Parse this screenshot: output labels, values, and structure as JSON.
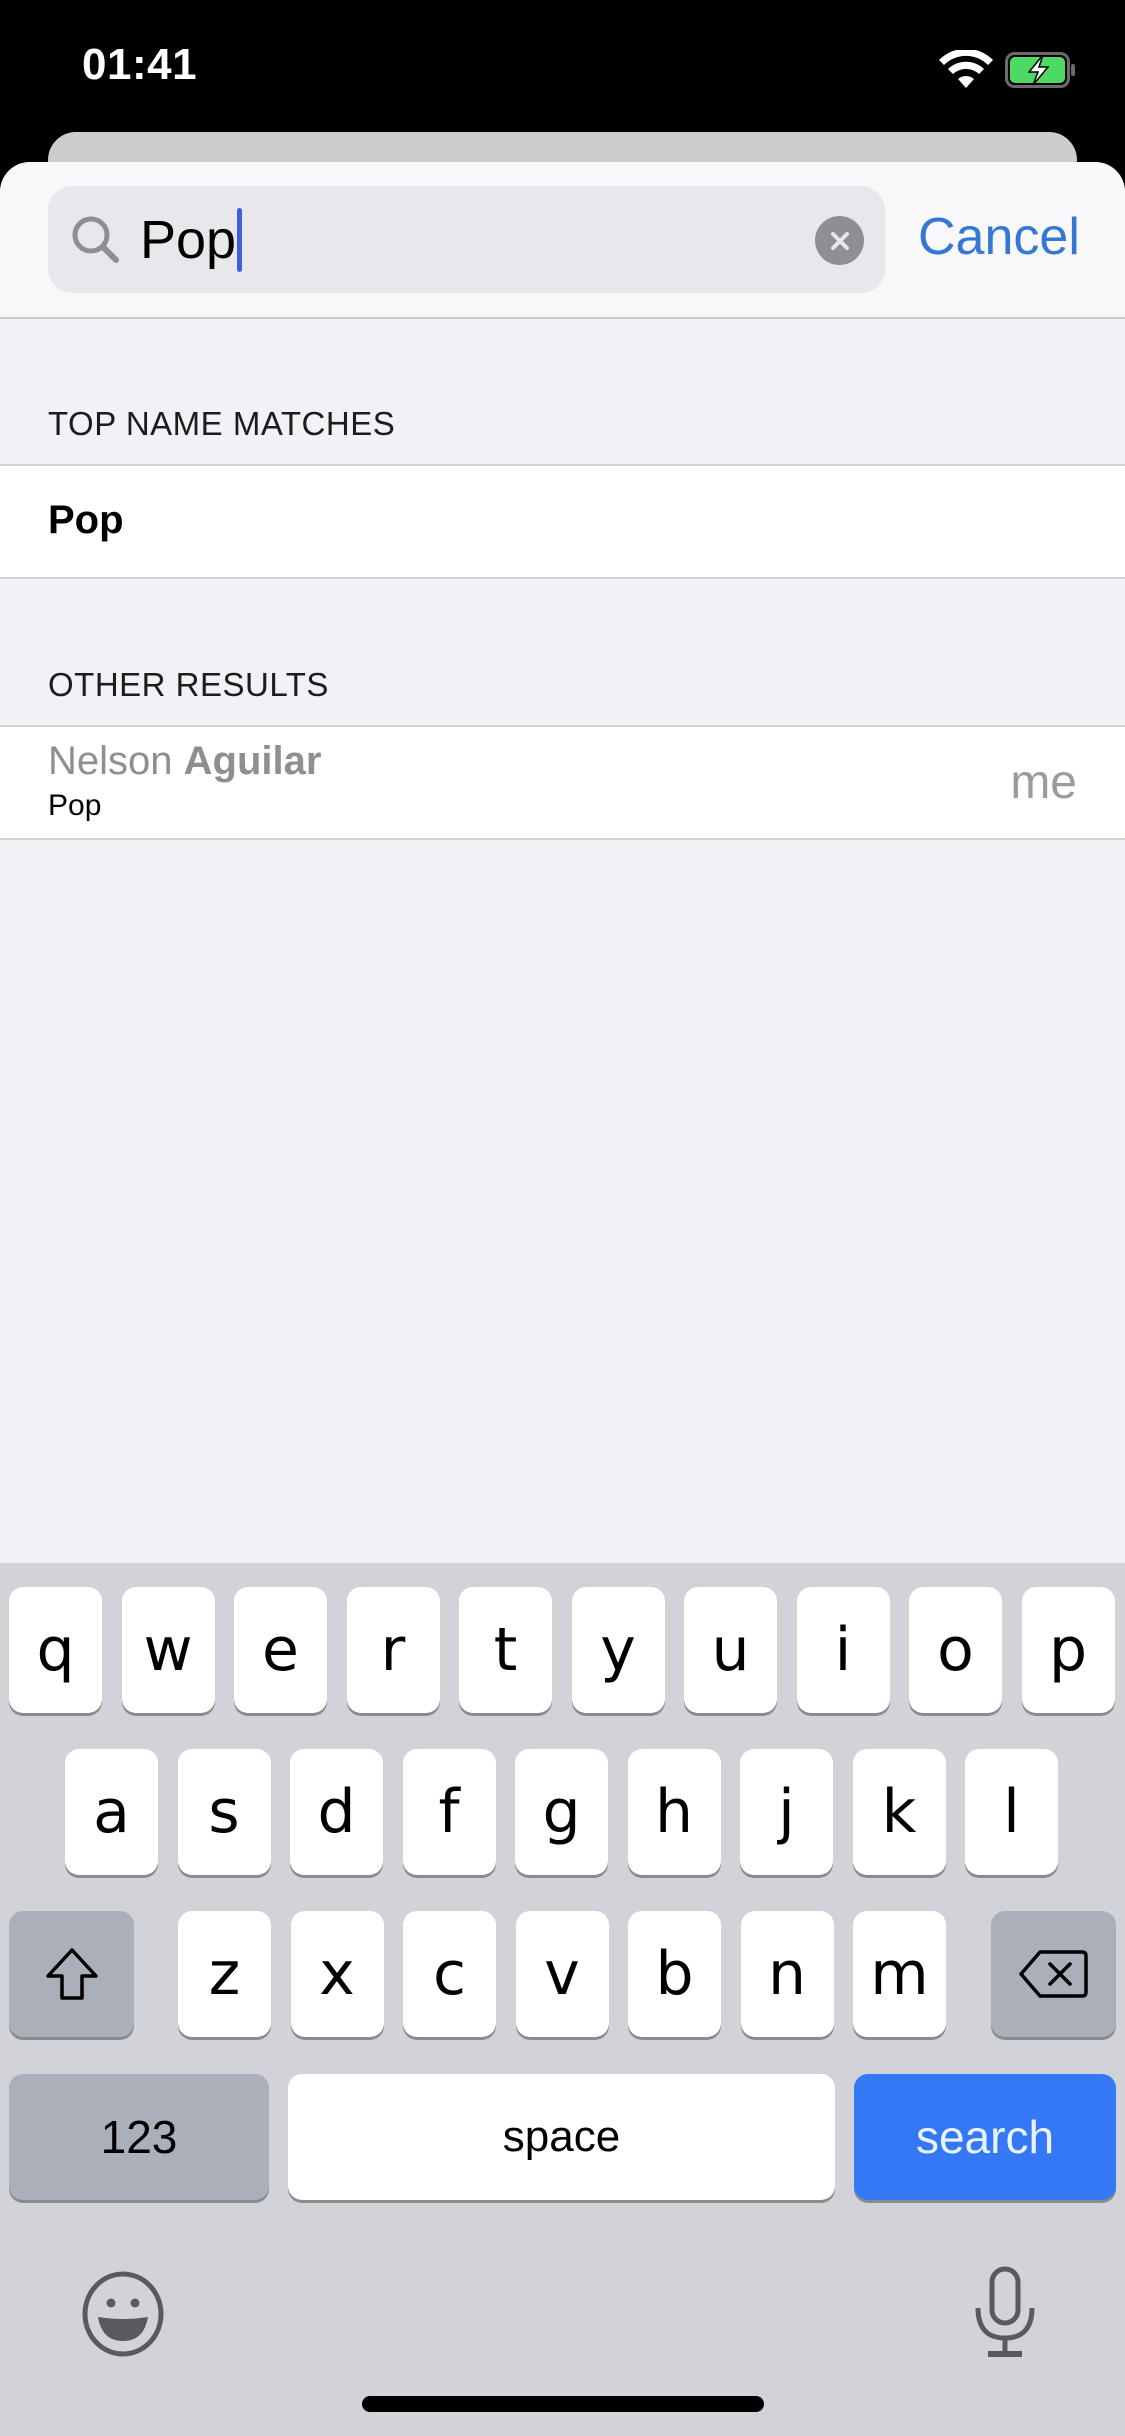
{
  "status_bar": {
    "time": "01:41",
    "wifi_icon": "wifi-icon",
    "battery_icon": "battery-charging-icon",
    "battery_color": "#4cd964"
  },
  "search": {
    "value": "Pop",
    "icon": "search-icon",
    "clear_icon": "clear-icon",
    "cancel_label": "Cancel",
    "accent_color": "#3478d6"
  },
  "sections": [
    {
      "header": "TOP NAME MATCHES",
      "rows": [
        {
          "title": "Pop"
        }
      ]
    },
    {
      "header": "OTHER RESULTS",
      "rows": [
        {
          "first_name": "Nelson",
          "last_name": "Aguilar",
          "subtitle": "Pop",
          "detail": "me"
        }
      ]
    }
  ],
  "keyboard": {
    "row1": [
      "q",
      "w",
      "e",
      "r",
      "t",
      "y",
      "u",
      "i",
      "o",
      "p"
    ],
    "row2": [
      "a",
      "s",
      "d",
      "f",
      "g",
      "h",
      "j",
      "k",
      "l"
    ],
    "row3": [
      "z",
      "x",
      "c",
      "v",
      "b",
      "n",
      "m"
    ],
    "shift_icon": "shift-icon",
    "delete_icon": "delete-icon",
    "numbers_label": "123",
    "space_label": "space",
    "return_label": "search",
    "return_color": "#3478f6",
    "emoji_icon": "emoji-icon",
    "mic_icon": "microphone-icon"
  }
}
